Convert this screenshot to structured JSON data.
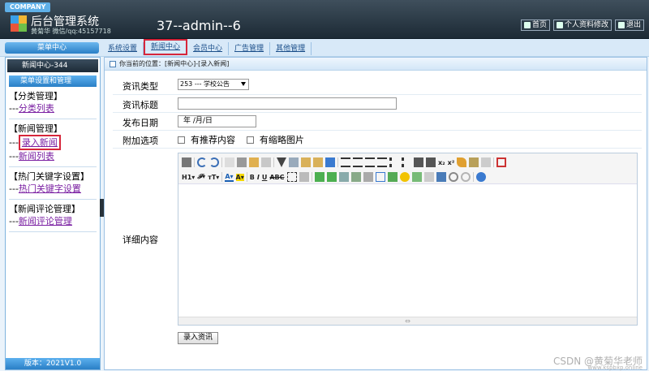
{
  "header": {
    "badge": "COMPANY",
    "app_title": "后台管理系统",
    "app_sub": "黄菊华 微信/qq:45157718",
    "user_title": "37--admin--6",
    "buttons": [
      {
        "label": "首页",
        "icon": "home-icon"
      },
      {
        "label": "个人资料修改",
        "icon": "profile-icon"
      },
      {
        "label": "退出",
        "icon": "power-icon"
      }
    ]
  },
  "nav": {
    "side_head": "菜单中心",
    "tabs": [
      "系统设置",
      "新闻中心",
      "会员中心",
      "广告管理",
      "其他管理"
    ],
    "active_tab": "新闻中心"
  },
  "sidebar": {
    "count_label": "新闻中心-344",
    "section_label": "菜单设置和管理",
    "groups": [
      {
        "title": "【分类管理】",
        "links": [
          "分类列表"
        ]
      },
      {
        "title": "【新闻管理】",
        "links": [
          "录入新闻",
          "新闻列表"
        ]
      },
      {
        "title": "【热门关键字设置】",
        "links": [
          "热门关键字设置"
        ]
      },
      {
        "title": "【新闻评论管理】",
        "links": [
          "新闻评论管理"
        ]
      }
    ],
    "link_prefix": "---",
    "version": "版本：2021V1.0"
  },
  "main": {
    "crumb_label": "你当前的位置：",
    "crumb_path": "[新闻中心]-[录入新闻]",
    "form": {
      "type_label": "资讯类型",
      "type_value": "253 --- 学校公告",
      "title_label": "资讯标题",
      "title_value": "",
      "date_label": "发布日期",
      "date_value": "年 /月/日",
      "options_label": "附加选项",
      "option_recommend": "有推荐内容",
      "option_thumb": "有缩略图片",
      "content_label": "详细内容",
      "submit_label": "录入资讯"
    }
  },
  "watermark": {
    "text": "CSDN @黄菊华老师",
    "small": "www.kspbxp.online"
  },
  "colors": {
    "accent": "#2a7fc6",
    "highlight": "#d6263b",
    "link": "#7a1fa2"
  }
}
